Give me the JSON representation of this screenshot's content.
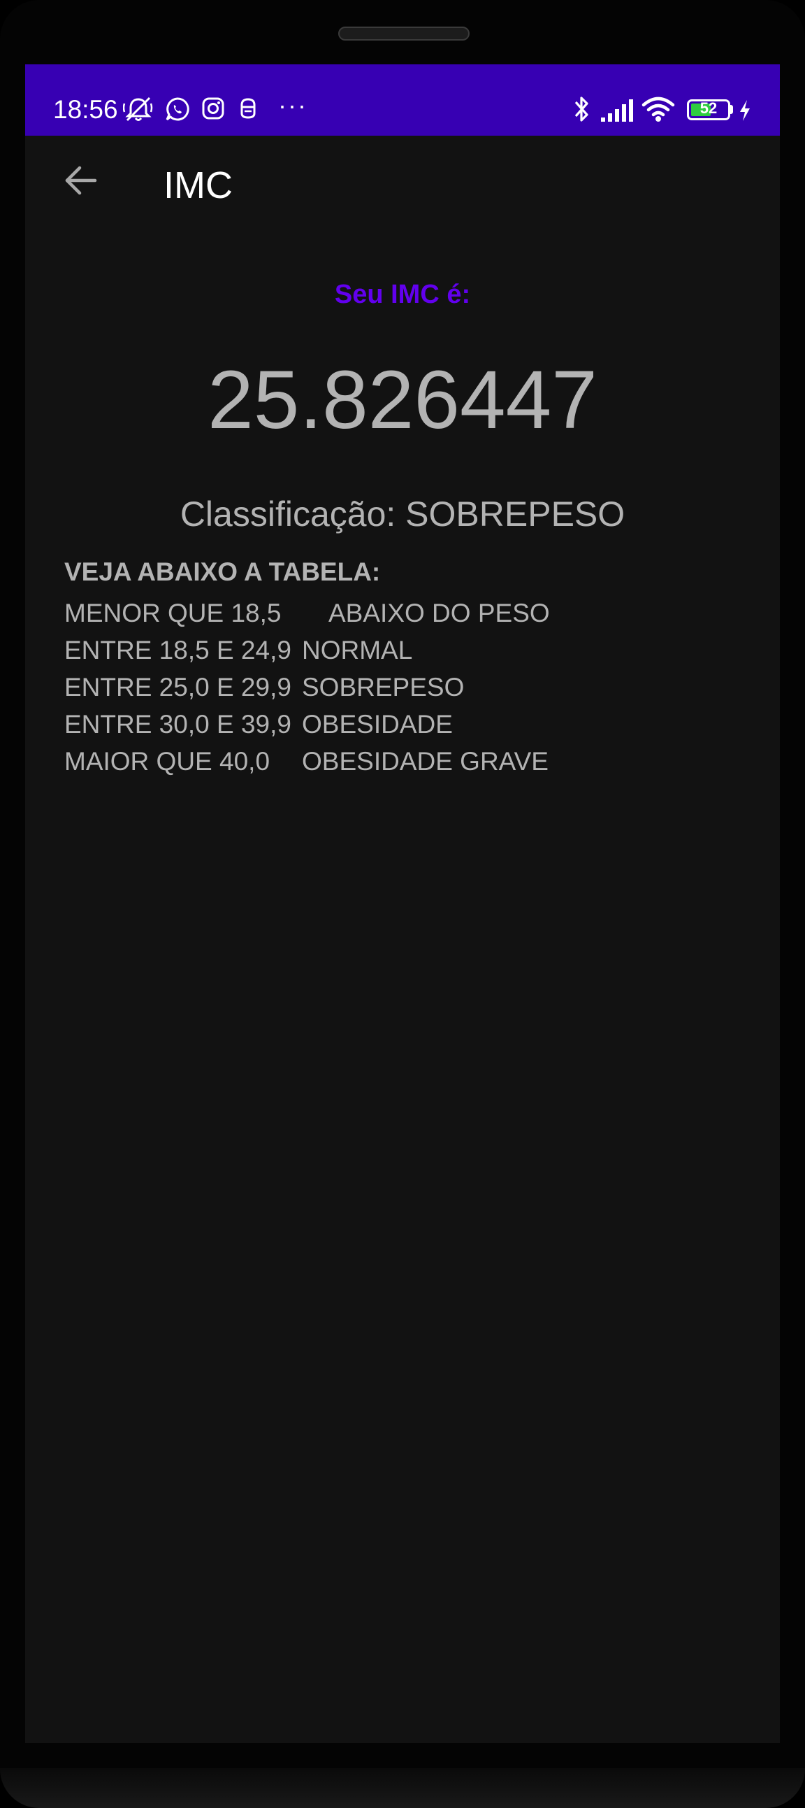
{
  "status_bar": {
    "time": "18:56",
    "battery_level": "52",
    "overflow": "···",
    "icons": [
      "muted-bell-icon",
      "whatsapp-icon",
      "instagram-icon",
      "app-notification-icon",
      "bluetooth-icon",
      "signal-icon",
      "wifi-icon",
      "battery-icon",
      "charging-icon"
    ],
    "bar_color": "#3700b3"
  },
  "toolbar": {
    "title": "IMC",
    "back_icon": "arrow-back-icon"
  },
  "result": {
    "label": "Seu IMC é:",
    "value": "25.826447",
    "classification": "Classificação: SOBREPESO",
    "label_color": "#6200ee"
  },
  "table": {
    "heading": "VEJA ABAIXO A TABELA:",
    "rows": [
      {
        "range": "MENOR QUE 18,5",
        "category": "ABAIXO DO PESO"
      },
      {
        "range": "ENTRE 18,5 E 24,9",
        "category": "NORMAL"
      },
      {
        "range": "ENTRE 25,0 E 29,9",
        "category": "SOBREPESO"
      },
      {
        "range": "ENTRE 30,0 E 39,9",
        "category": "OBESIDADE"
      },
      {
        "range": "MAIOR QUE 40,0",
        "category": "OBESIDADE GRAVE"
      }
    ]
  }
}
